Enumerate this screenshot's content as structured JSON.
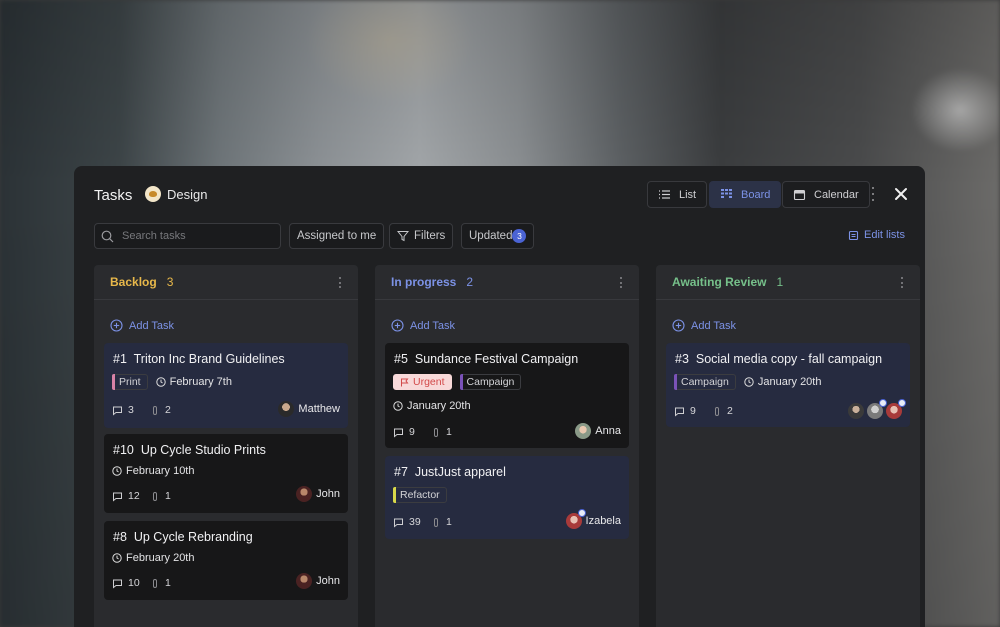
{
  "header": {
    "title": "Tasks",
    "project": "Design",
    "views": [
      {
        "label": "List",
        "icon": "list-icon",
        "active": false
      },
      {
        "label": "Board",
        "icon": "board-icon",
        "active": true
      },
      {
        "label": "Calendar",
        "icon": "calendar-icon",
        "active": false
      }
    ]
  },
  "toolbar": {
    "search_placeholder": "Search tasks",
    "assigned_label": "Assigned to me",
    "filters_label": "Filters",
    "updated_label": "Updated",
    "updated_count": "3",
    "edit_lists_label": "Edit lists"
  },
  "colors": {
    "accent": "#7c92e6",
    "backlog": "#e8b84a",
    "in_progress": "#7c92e6",
    "awaiting_review": "#76c08a",
    "print_tag": "#d882a6",
    "campaign_tag": "#7a52b8",
    "refactor_tag": "#d8d84a",
    "urgent": "#d24a4a"
  },
  "columns": [
    {
      "title": "Backlog",
      "count": "3",
      "add_label": "Add Task",
      "cards": [
        {
          "id": "#1",
          "title": "Triton Inc Brand Guidelines",
          "tag": "Print",
          "date": "February 7th",
          "comments": "3",
          "attachments": "2",
          "assignee": "Matthew"
        },
        {
          "id": "#10",
          "title": "Up Cycle Studio Prints",
          "date": "February 10th",
          "comments": "12",
          "attachments": "1",
          "assignee": "John"
        },
        {
          "id": "#8",
          "title": "Up Cycle Rebranding",
          "date": "February 20th",
          "comments": "10",
          "attachments": "1",
          "assignee": "John"
        }
      ]
    },
    {
      "title": "In progress",
      "count": "2",
      "add_label": "Add Task",
      "cards": [
        {
          "id": "#5",
          "title": "Sundance Festival Campaign",
          "priority": "Urgent",
          "tag": "Campaign",
          "date": "January 20th",
          "comments": "9",
          "attachments": "1",
          "assignee": "Anna"
        },
        {
          "id": "#7",
          "title": "JustJust apparel",
          "tag": "Refactor",
          "comments": "39",
          "attachments": "1",
          "assignee": "Izabela"
        }
      ]
    },
    {
      "title": "Awaiting Review",
      "count": "1",
      "add_label": "Add Task",
      "cards": [
        {
          "id": "#3",
          "title": "Social media copy - fall campaign",
          "tag": "Campaign",
          "date": "January 20th",
          "comments": "9",
          "attachments": "2"
        }
      ]
    }
  ]
}
